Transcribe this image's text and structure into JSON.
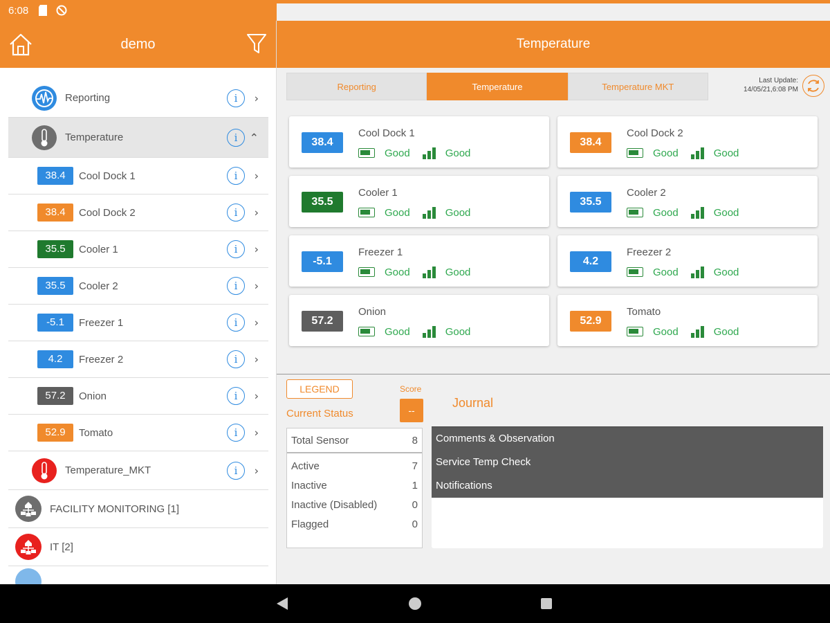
{
  "status_bar": {
    "time": "6:08"
  },
  "sidebar": {
    "title": "demo",
    "items": [
      {
        "type": "group",
        "label": "Reporting",
        "icon": "pulse-icon",
        "color": "#2f8be0",
        "expand": "›"
      },
      {
        "type": "group",
        "label": "Temperature",
        "icon": "thermometer-icon",
        "color": "#6e6e6e",
        "expand": "⌃",
        "selected": true
      },
      {
        "type": "sensor",
        "value": "38.4",
        "label": "Cool Dock 1",
        "color": "#2f8be0"
      },
      {
        "type": "sensor",
        "value": "38.4",
        "label": "Cool Dock 2",
        "color": "#f08a2c"
      },
      {
        "type": "sensor",
        "value": "35.5",
        "label": "Cooler 1",
        "color": "#1f7a2e"
      },
      {
        "type": "sensor",
        "value": "35.5",
        "label": "Cooler 2",
        "color": "#2f8be0"
      },
      {
        "type": "sensor",
        "value": "-5.1",
        "label": "Freezer 1",
        "color": "#2f8be0"
      },
      {
        "type": "sensor",
        "value": "4.2",
        "label": "Freezer 2",
        "color": "#2f8be0"
      },
      {
        "type": "sensor",
        "value": "57.2",
        "label": "Onion",
        "color": "#5e5e5e"
      },
      {
        "type": "sensor",
        "value": "52.9",
        "label": "Tomato",
        "color": "#f08a2c"
      },
      {
        "type": "group",
        "label": "Temperature_MKT",
        "icon": "thermometer-icon",
        "color": "#e8211e",
        "expand": "›"
      }
    ],
    "categories": [
      {
        "label": "FACILITY MONITORING [1]",
        "icon": "network-icon",
        "color": "#6e6e6e"
      },
      {
        "label": "IT [2]",
        "icon": "network-icon",
        "color": "#e8211e"
      }
    ]
  },
  "main": {
    "title": "Temperature",
    "tabs": [
      {
        "label": "Reporting",
        "active": false
      },
      {
        "label": "Temperature",
        "active": true
      },
      {
        "label": "Temperature MKT",
        "active": false
      }
    ],
    "last_update_label": "Last Update:",
    "last_update_value": "14/05/21,6:08 PM",
    "cards": [
      {
        "value": "38.4",
        "name": "Cool Dock 1",
        "color": "#2f8be0",
        "battery": "Good",
        "signal": "Good"
      },
      {
        "value": "38.4",
        "name": "Cool Dock 2",
        "color": "#f08a2c",
        "battery": "Good",
        "signal": "Good"
      },
      {
        "value": "35.5",
        "name": "Cooler 1",
        "color": "#1f7a2e",
        "battery": "Good",
        "signal": "Good"
      },
      {
        "value": "35.5",
        "name": "Cooler 2",
        "color": "#2f8be0",
        "battery": "Good",
        "signal": "Good"
      },
      {
        "value": "-5.1",
        "name": "Freezer 1",
        "color": "#2f8be0",
        "battery": "Good",
        "signal": "Good"
      },
      {
        "value": "4.2",
        "name": "Freezer 2",
        "color": "#2f8be0",
        "battery": "Good",
        "signal": "Good"
      },
      {
        "value": "57.2",
        "name": "Onion",
        "color": "#5e5e5e",
        "battery": "Good",
        "signal": "Good"
      },
      {
        "value": "52.9",
        "name": "Tomato",
        "color": "#f08a2c",
        "battery": "Good",
        "signal": "Good"
      }
    ],
    "legend_label": "LEGEND",
    "score_label": "Score",
    "score_value": "--",
    "current_status_label": "Current Status",
    "stats": {
      "total": {
        "label": "Total Sensor",
        "value": "8"
      },
      "rows": [
        {
          "label": "Active",
          "value": "7"
        },
        {
          "label": "Inactive",
          "value": "1"
        },
        {
          "label": "Inactive (Disabled)",
          "value": "0"
        },
        {
          "label": "Flagged",
          "value": "0"
        }
      ]
    },
    "journal_title": "Journal",
    "journal_items": [
      "Comments & Observation",
      "Service Temp Check",
      "Notifications"
    ]
  },
  "colors": {
    "accent": "#f08a2c",
    "good": "#2fa84f"
  }
}
